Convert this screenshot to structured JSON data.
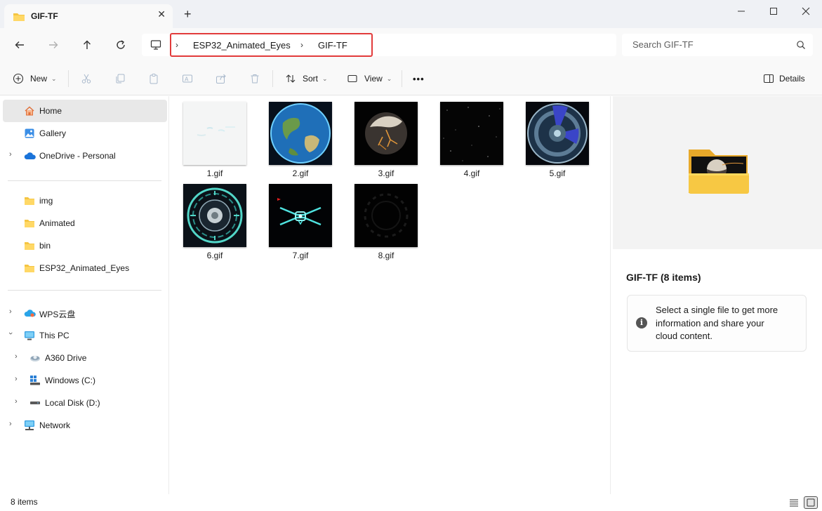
{
  "window": {
    "tab_title": "GIF-TF",
    "tab_close": "✕",
    "new_tab": "+"
  },
  "address_bar": {
    "breadcrumbs": [
      "ESP32_Animated_Eyes",
      "GIF-TF"
    ],
    "search_placeholder": "Search GIF-TF"
  },
  "command_bar": {
    "new_label": "New",
    "sort_label": "Sort",
    "view_label": "View",
    "more_label": "•••",
    "details_label": "Details"
  },
  "sidebar": {
    "home": "Home",
    "gallery": "Gallery",
    "onedrive": "OneDrive - Personal",
    "quick_access": [
      "img",
      "Animated",
      "bin",
      "ESP32_Animated_Eyes"
    ],
    "wps": "WPS云盘",
    "this_pc": "This PC",
    "drives": [
      "A360 Drive",
      "Windows (C:)",
      "Local Disk (D:)"
    ],
    "network": "Network"
  },
  "files": [
    "1.gif",
    "2.gif",
    "3.gif",
    "4.gif",
    "5.gif",
    "6.gif",
    "7.gif",
    "8.gif"
  ],
  "details_pane": {
    "title": "GIF-TF (8 items)",
    "info_line1": "Select a single file to get more",
    "info_line2": "information and share your",
    "info_line3": "cloud content."
  },
  "status": {
    "item_count": "8 items"
  },
  "colors": {
    "highlight_box": "#e23b3b",
    "folder_yellow": "#f5c542",
    "selected_bg": "#e8e8e8"
  }
}
